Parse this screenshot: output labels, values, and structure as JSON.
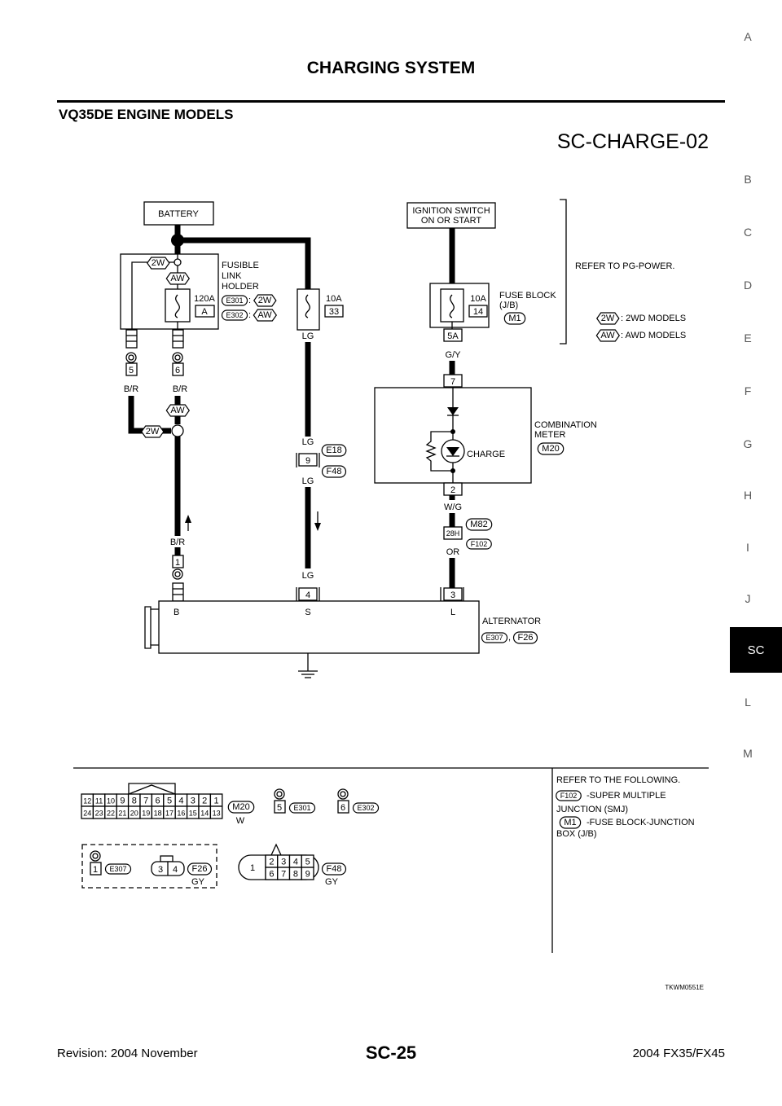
{
  "header": {
    "title": "CHARGING SYSTEM",
    "section": "VQ35DE ENGINE MODELS",
    "diagram_id": "SC-CHARGE-02"
  },
  "side_tabs": [
    "A",
    "B",
    "C",
    "D",
    "E",
    "F",
    "G",
    "H",
    "I",
    "J",
    "SC",
    "L",
    "M"
  ],
  "active_tab": "SC",
  "footer": {
    "revision": "Revision: 2004 November",
    "page": "SC-25",
    "model": "2004 FX35/FX45",
    "figure_code": "TKWM0551E"
  },
  "diagram": {
    "battery": "BATTERY",
    "fusible_link_holder": [
      "FUSIBLE",
      "LINK",
      "HOLDER"
    ],
    "fuse_120a": {
      "rating": "120A",
      "location": "A"
    },
    "holder_connectors": [
      {
        "id": "E301",
        "sep": ":",
        "variant": "2W"
      },
      {
        "id": "E302",
        "sep": ":",
        "variant": "AW"
      }
    ],
    "fuse_10a_33": {
      "rating": "10A",
      "location": "33"
    },
    "ignition_switch": [
      "IGNITION SWITCH",
      "ON OR START"
    ],
    "fuse_block": {
      "rating": "10A",
      "location": "14",
      "label": [
        "FUSE BLOCK",
        "(J/B)"
      ],
      "connector": "M1",
      "terminal": "5A"
    },
    "refer": "REFER TO PG-POWER.",
    "legend": [
      {
        "tag": "2W",
        "text": ": 2WD MODELS"
      },
      {
        "tag": "AW",
        "text": ": AWD MODELS"
      }
    ],
    "variant_tags": {
      "w2": "2W",
      "aw": "AW"
    },
    "terminals": {
      "t5": "5",
      "t6": "6",
      "t1": "1",
      "t9": "9",
      "t4": "4",
      "t7": "7",
      "t2": "2",
      "t28h": "28H",
      "t3": "3"
    },
    "wire_colors": {
      "br_a": "B/R",
      "br_b": "B/R",
      "br_c": "B/R",
      "lg_a": "LG",
      "lg_b": "LG",
      "lg_c": "LG",
      "lg_d": "LG",
      "gy": "G/Y",
      "wg": "W/G",
      "or": "OR"
    },
    "joint_connectors": {
      "e18": "E18",
      "f48": "F48",
      "m82": "M82",
      "f102": "F102"
    },
    "combination_meter": {
      "label": [
        "COMBINATION",
        "METER"
      ],
      "connector": "M20",
      "lamp": "CHARGE"
    },
    "alternator": {
      "label": "ALTERNATOR",
      "terminals": [
        "B",
        "S",
        "L"
      ],
      "connectors": [
        "E307",
        "F26"
      ],
      "sep": ","
    }
  },
  "connector_views": {
    "m20": {
      "id": "M20",
      "color": "W",
      "row1": [
        "12",
        "11",
        "10",
        "9",
        "8",
        "7",
        "6",
        "5",
        "4",
        "3",
        "2",
        "1"
      ],
      "row2": [
        "24",
        "23",
        "22",
        "21",
        "20",
        "19",
        "18",
        "17",
        "16",
        "15",
        "14",
        "13"
      ]
    },
    "e301": {
      "id": "E301",
      "pin": "5"
    },
    "e302": {
      "id": "E302",
      "pin": "6"
    },
    "e307": {
      "id": "E307",
      "pin": "1"
    },
    "f26": {
      "id": "F26",
      "color": "GY",
      "pins": [
        "3",
        "4"
      ]
    },
    "f48": {
      "id": "F48",
      "color": "GY",
      "big": "1",
      "row1": [
        "2",
        "3",
        "4",
        "5"
      ],
      "row2": [
        "6",
        "7",
        "8",
        "9"
      ]
    }
  },
  "reference": {
    "title": "REFER TO THE FOLLOWING.",
    "items": [
      {
        "tag": "F102",
        "line1": "-SUPER MULTIPLE",
        "line2": "JUNCTION (SMJ)"
      },
      {
        "tag": "M1",
        "line1": "-FUSE BLOCK-JUNCTION",
        "line2": "BOX (J/B)"
      }
    ]
  }
}
